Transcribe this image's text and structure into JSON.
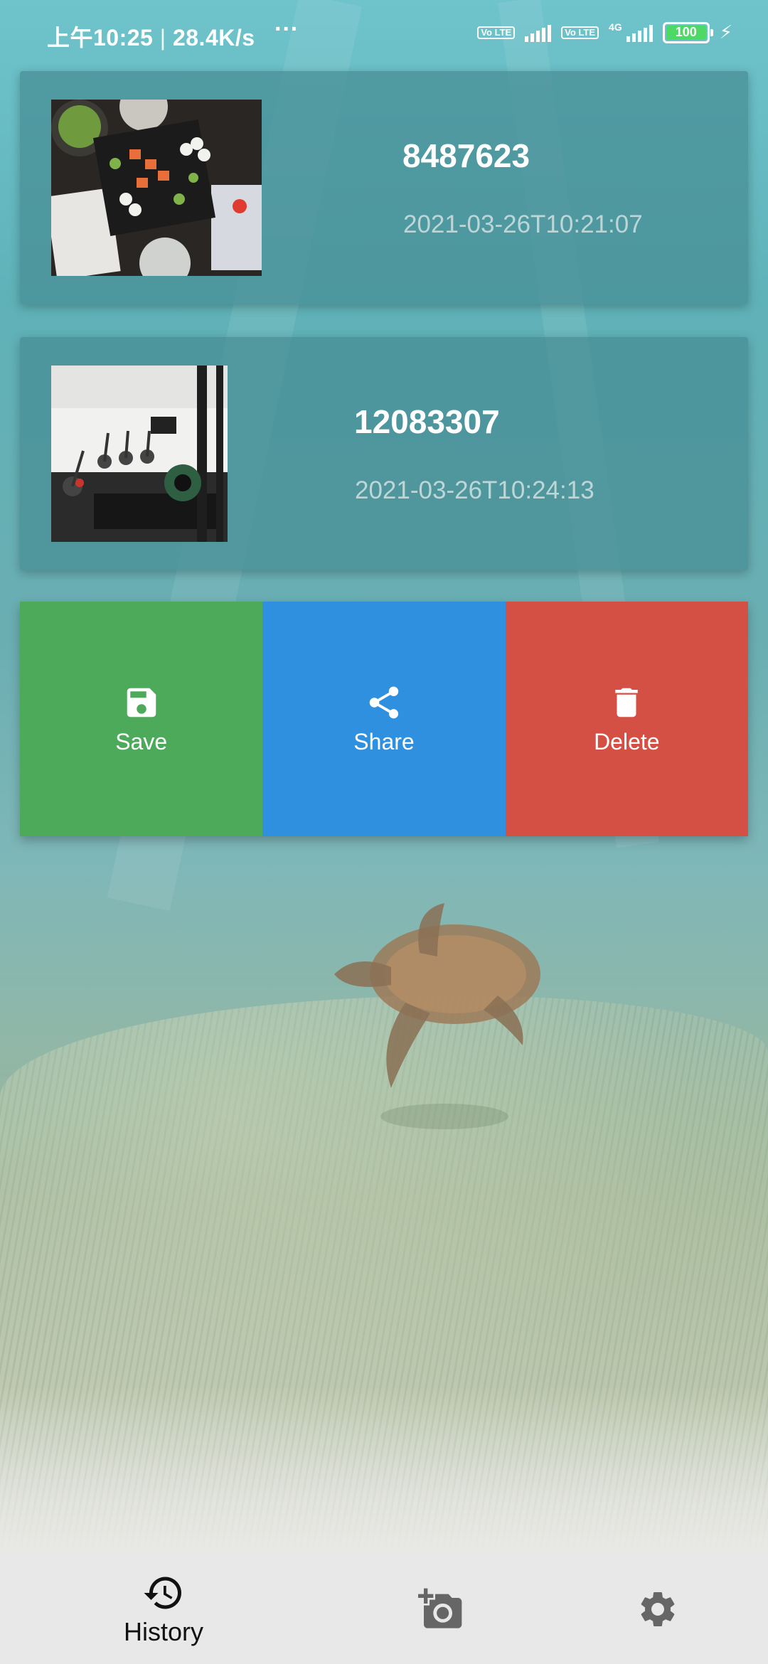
{
  "status_bar": {
    "time": "上午10:25",
    "separator": "|",
    "speed": "28.4K/s",
    "dots": "···",
    "volte": "Vo LTE",
    "network": "4G",
    "battery": "100"
  },
  "history": [
    {
      "title": "8487623",
      "timestamp": "2021-03-26T10:21:07",
      "thumbnail": "sushi-platter-photo"
    },
    {
      "title": "12083307",
      "timestamp": "2021-03-26T10:24:13",
      "thumbnail": "gym-bikes-photo"
    }
  ],
  "actions": {
    "save": {
      "label": "Save",
      "icon": "floppy-disk-icon",
      "color": "#4caa5a"
    },
    "share": {
      "label": "Share",
      "icon": "share-icon",
      "color": "#2e90df"
    },
    "delete": {
      "label": "Delete",
      "icon": "trash-icon",
      "color": "#d44f44"
    }
  },
  "bottom_nav": {
    "history": {
      "label": "History",
      "icon": "history-icon",
      "active": true
    },
    "camera": {
      "icon": "add-photo-icon"
    },
    "settings": {
      "icon": "gear-icon"
    }
  },
  "colors": {
    "card_overlay": "#468c94",
    "nav_bg": "#e8e8e8"
  }
}
